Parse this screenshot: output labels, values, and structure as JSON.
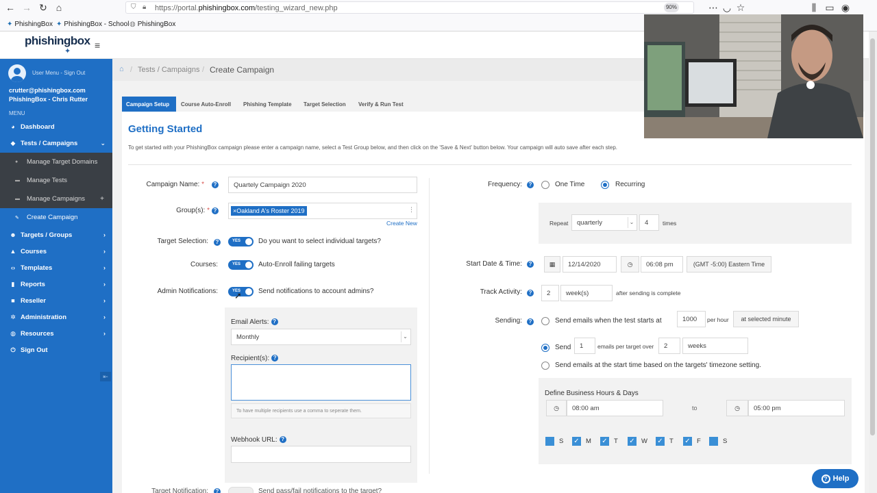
{
  "browser": {
    "url_prefix": "https://portal.",
    "url_domain": "phishingbox.com",
    "url_path": "/testing_wizard_new.php",
    "zoom": "90%",
    "bookmarks": [
      "PhishingBox",
      "PhishingBox - School",
      "PhishingBox"
    ]
  },
  "header": {
    "logo_a": "phishing",
    "logo_b": "box"
  },
  "user": {
    "menu": "User Menu - Sign Out",
    "email": "crutter@phishingbox.com",
    "org": "PhishingBox - Chris Rutter"
  },
  "sidebar": {
    "menu_label": "MENU",
    "items": [
      {
        "label": "Dashboard",
        "icon": "gauge-icon"
      },
      {
        "label": "Tests / Campaigns",
        "icon": "cube-icon"
      },
      {
        "label": "Targets / Groups",
        "icon": "users-icon"
      },
      {
        "label": "Courses",
        "icon": "graduation-icon"
      },
      {
        "label": "Templates",
        "icon": "code-icon"
      },
      {
        "label": "Reports",
        "icon": "chart-icon"
      },
      {
        "label": "Reseller",
        "icon": "briefcase-icon"
      },
      {
        "label": "Administration",
        "icon": "cog-icon"
      },
      {
        "label": "Resources",
        "icon": "globe-icon"
      },
      {
        "label": "Sign Out",
        "icon": "power-icon"
      }
    ],
    "sub_items": [
      {
        "label": "Manage Target Domains"
      },
      {
        "label": "Manage Tests"
      },
      {
        "label": "Manage Campaigns"
      },
      {
        "label": "Create Campaign"
      }
    ]
  },
  "breadcrumb": {
    "parent": "Tests / Campaigns",
    "current": "Create Campaign"
  },
  "tabs": [
    "Campaign Setup",
    "Course Auto-Enroll",
    "Phishing Template",
    "Target Selection",
    "Verify & Run Test"
  ],
  "page": {
    "title": "Getting Started",
    "intro": "To get started with your PhishingBox campaign please enter a campaign name, select a Test Group below, and then click on the 'Save & Next' button below. Your campaign will auto save after each step."
  },
  "form": {
    "campaign_name_label": "Campaign Name:",
    "campaign_name_value": "Quartely Campaign 2020",
    "groups_label": "Group(s):",
    "group_tag": "×Oakland A's Roster 2019",
    "create_new": "Create New",
    "target_selection_label": "Target Selection:",
    "target_selection_text": "Do you want to select individual targets?",
    "courses_label": "Courses:",
    "courses_text": "Auto-Enroll failing targets",
    "admin_notif_label": "Admin Notifications:",
    "admin_notif_text": "Send notifications to account admins?",
    "toggle_yes": "YES",
    "email_alerts_label": "Email Alerts:",
    "email_alerts_value": "Monthly",
    "recipients_label": "Recipient(s):",
    "recipients_hint": "To have multiple recipients use a comma to seperate them.",
    "webhook_label": "Webhook URL:",
    "target_notif_label": "Target Notification:",
    "target_notif_text": "Send pass/fail notifications to the target?"
  },
  "schedule": {
    "frequency_label": "Frequency:",
    "one_time": "One Time",
    "recurring": "Recurring",
    "repeat_label": "Repeat",
    "repeat_value": "quarterly",
    "repeat_count": "4",
    "times": "times",
    "start_label": "Start Date & Time:",
    "start_date": "12/14/2020",
    "start_time": "06:08 pm",
    "timezone": "(GMT -5:00) Eastern Time",
    "track_label": "Track Activity:",
    "track_count": "2",
    "track_unit": "week(s)",
    "track_after": "after sending is complete",
    "sending_label": "Sending:",
    "send_opt1": "Send emails when the test starts at",
    "per_hour_value": "1000",
    "per_hour": "per hour",
    "at_selected": "at selected minute",
    "send_opt2": "Send",
    "per_target_value": "1",
    "per_target": "emails per target over",
    "over_value": "2",
    "over_unit": "weeks",
    "send_opt3": "Send emails at the start time based on the targets' timezone setting.",
    "business_hours_label": "Define Business Hours & Days",
    "from_time": "08:00 am",
    "to": "to",
    "to_time": "05:00 pm",
    "days": [
      "S",
      "M",
      "T",
      "W",
      "T",
      "F",
      "S"
    ],
    "days_checked": [
      false,
      true,
      true,
      true,
      true,
      true,
      false
    ]
  },
  "help_button": "Help"
}
